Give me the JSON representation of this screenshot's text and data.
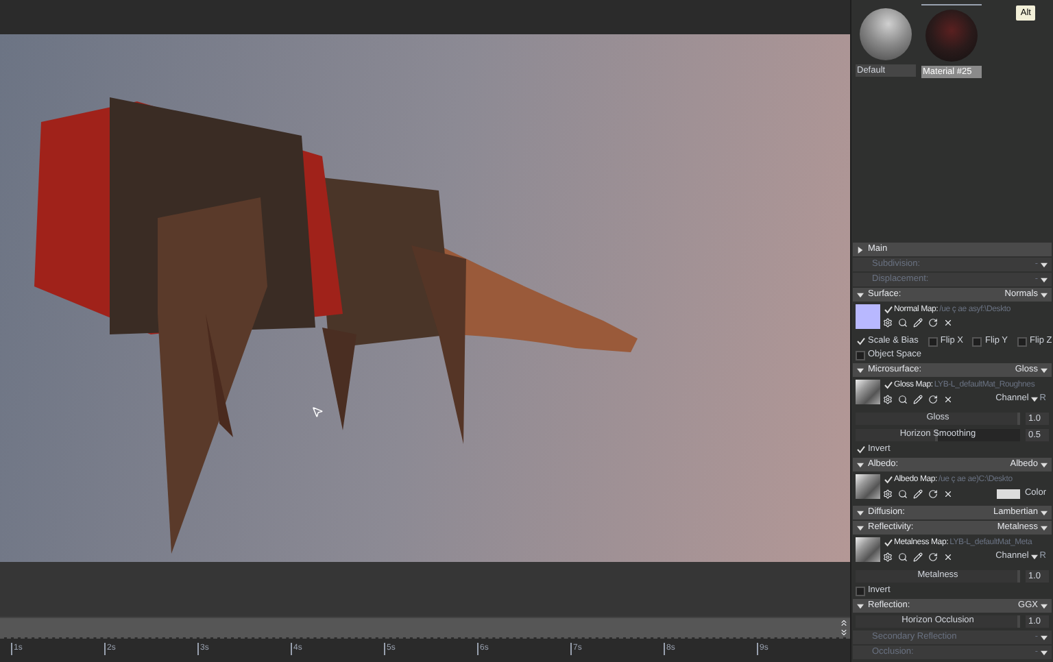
{
  "materials": [
    {
      "name": "Default",
      "selected": false,
      "kind": "plain"
    },
    {
      "name": "Material #25",
      "selected": true,
      "kind": "textured"
    }
  ],
  "alt_badge": "Alt",
  "sections": [
    {
      "title": "Main",
      "expanded": false,
      "enabled": true
    },
    {
      "title": "Subdivision:",
      "value": "-",
      "enabled": false
    },
    {
      "title": "Displacement:",
      "value": "-",
      "enabled": false
    },
    {
      "title": "Surface:",
      "value": "Normals",
      "expanded": true,
      "enabled": true,
      "rows": [
        {
          "kind": "map",
          "thumb": {
            "kind": "solid",
            "color": "#b8b8ff"
          },
          "label": "Normal Map:",
          "path": "/ue   ç   ae   asyf:\\Deskto",
          "checked": true
        },
        {
          "kind": "checks",
          "items": [
            {
              "label": "Scale & Bias",
              "checked": true
            },
            {
              "label": "Flip X",
              "checked": false
            },
            {
              "label": "Flip Y",
              "checked": false
            },
            {
              "label": "Flip Z",
              "checked": false
            }
          ]
        },
        {
          "kind": "checks",
          "items": [
            {
              "label": "Object Space",
              "checked": false
            }
          ]
        }
      ]
    },
    {
      "title": "Microsurface:",
      "value": "Gloss",
      "expanded": true,
      "enabled": true,
      "rows": [
        {
          "kind": "map",
          "thumb": {
            "kind": "texture"
          },
          "label": "Gloss Map:",
          "path": "LYB-L_defaultMat_Roughnes",
          "checked": true,
          "channel": "Channel",
          "channel_value": "R"
        },
        {
          "kind": "slider",
          "label": "Gloss",
          "level": 1,
          "reading": "1.0"
        },
        {
          "kind": "slider",
          "label": "Horizon Smoothing",
          "level": 0.5,
          "reading": "0.5"
        },
        {
          "kind": "checks",
          "items": [
            {
              "label": "Invert",
              "checked": true
            }
          ]
        }
      ]
    },
    {
      "title": "Albedo:",
      "value": "Albedo",
      "expanded": true,
      "enabled": true,
      "rows": [
        {
          "kind": "map",
          "thumb": {
            "kind": "texture"
          },
          "label": "Albedo Map:",
          "path": "/ue   ç   ae   ae)C:\\Deskto",
          "checked": true,
          "color_label": "Color"
        }
      ]
    },
    {
      "title": "Diffusion:",
      "value": "Lambertian",
      "expanded": true,
      "enabled": true
    },
    {
      "title": "Reflectivity:",
      "value": "Metalness",
      "expanded": true,
      "enabled": true,
      "rows": [
        {
          "kind": "map",
          "thumb": {
            "kind": "texture"
          },
          "label": "Metalness Map:",
          "path": "LYB-L_defaultMat_Meta",
          "checked": true,
          "channel": "Channel",
          "channel_value": "R"
        },
        {
          "kind": "slider",
          "label": "Metalness",
          "level": 1,
          "reading": "1.0"
        },
        {
          "kind": "checks",
          "items": [
            {
              "label": "Invert",
              "checked": false
            }
          ]
        }
      ]
    },
    {
      "title": "Reflection:",
      "value": "GGX",
      "expanded": true,
      "enabled": true,
      "rows": [
        {
          "kind": "slider",
          "label": "Horizon Occlusion",
          "level": 1,
          "reading": "1.0"
        }
      ]
    },
    {
      "title": "Secondary Reflection",
      "value": "-",
      "enabled": false
    },
    {
      "title": "Occlusion:",
      "value": "-",
      "enabled": false
    }
  ],
  "timeline": {
    "ticks": [
      "1s",
      "2s",
      "3s",
      "4s",
      "5s",
      "6s",
      "7s",
      "8s",
      "9s"
    ]
  }
}
